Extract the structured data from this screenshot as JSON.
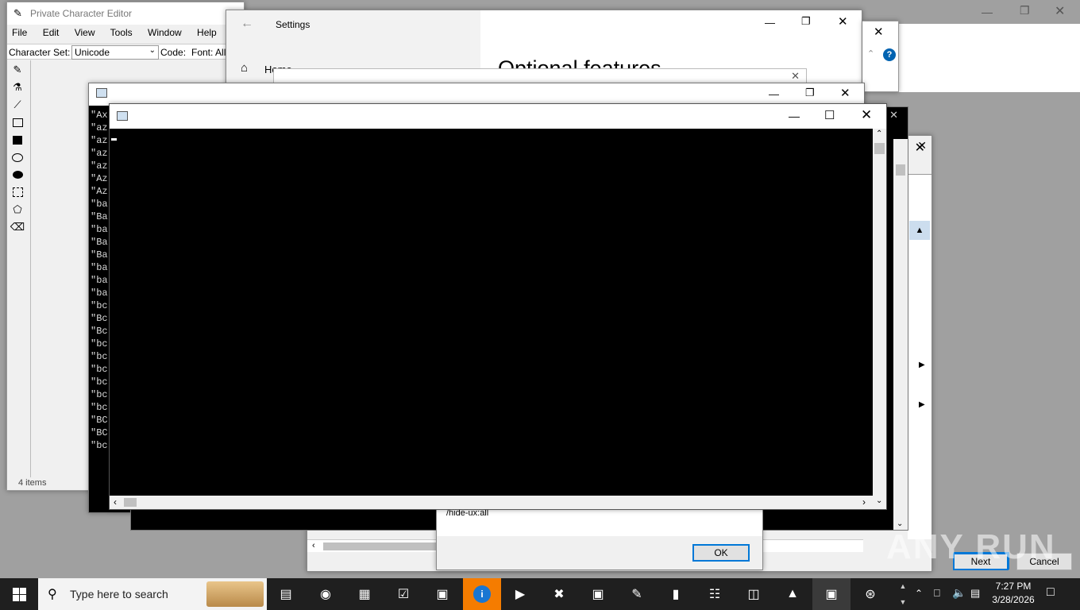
{
  "desktop": {
    "bg": "#a0a0a0"
  },
  "pce": {
    "title": "Private Character Editor",
    "menu": [
      "File",
      "Edit",
      "View",
      "Tools",
      "Window",
      "Help"
    ],
    "charset_label": "Character Set:",
    "charset_value": "Unicode",
    "code_label": "Code:",
    "font_label": "Font: All",
    "status": "4 items",
    "tools": [
      "pencil-icon",
      "brush-icon",
      "line-icon",
      "hollow-rect-icon",
      "filled-rect-icon",
      "hollow-ellipse-icon",
      "filled-ellipse-icon",
      "rect-select-icon",
      "freeform-select-icon",
      "eraser-icon"
    ]
  },
  "settings": {
    "title": "Settings",
    "home_label": "Home",
    "heading": "Optional features"
  },
  "console_back": {
    "lines": [
      "\"Ax",
      "\"az",
      "\"az",
      "\"az",
      "\"az",
      "\"Az",
      "\"Az",
      "\"ba",
      "\"Ba",
      "\"ba",
      "\"Ba",
      "\"Ba",
      "\"ba",
      "\"ba",
      "\"ba",
      "\"bc",
      "\"Bc",
      "\"Bc",
      "\"bc",
      "\"bc",
      "\"bc",
      "\"bc",
      "\"bc",
      "\"bc",
      "\"BC",
      "\"BC",
      "\"bc"
    ]
  },
  "dialog": {
    "text": "/hide-ux:all",
    "ok_label": "OK"
  },
  "wizard": {
    "next_label": "Next",
    "cancel_label": "Cancel"
  },
  "taskbar": {
    "search_placeholder": "Type here to search",
    "time": "7:27 PM",
    "date": "3/28/2026",
    "bg": "#1f1f1f",
    "accent": "#f57c00"
  },
  "watermark": "ANY RUN"
}
